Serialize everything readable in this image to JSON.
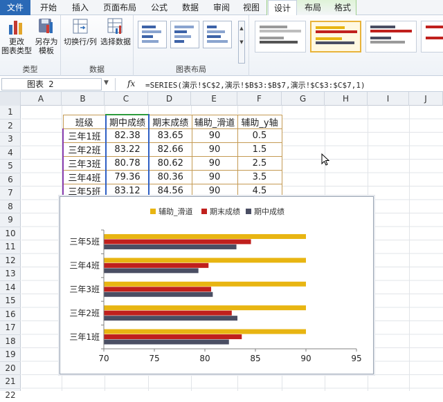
{
  "ribbon": {
    "tabs": [
      {
        "label": "文件"
      },
      {
        "label": "开始"
      },
      {
        "label": "插入"
      },
      {
        "label": "页面布局"
      },
      {
        "label": "公式"
      },
      {
        "label": "数据"
      },
      {
        "label": "审阅"
      },
      {
        "label": "视图"
      },
      {
        "label": "设计"
      },
      {
        "label": "布局"
      },
      {
        "label": "格式"
      }
    ],
    "groups": {
      "type": {
        "label": "类型",
        "change_type": "更改\n图表类型",
        "save_template": "另存为\n模板"
      },
      "data": {
        "label": "数据",
        "switch_row_col": "切换行/列",
        "select_data": "选择数据"
      },
      "layout": {
        "label": "图表布局"
      }
    }
  },
  "formula_bar": {
    "name_box": "图表 2",
    "fx": "fx",
    "formula": "=SERIES(演示!$C$2,演示!$B$3:$B$7,演示!$C$3:$C$7,1)"
  },
  "columns": [
    "A",
    "B",
    "C",
    "D",
    "E",
    "F",
    "G",
    "H",
    "I",
    "J"
  ],
  "rows": [
    "1",
    "2",
    "3",
    "4",
    "5",
    "6",
    "7",
    "8",
    "9",
    "10",
    "11",
    "12",
    "13",
    "14",
    "15",
    "16",
    "17",
    "18",
    "19",
    "20",
    "21",
    "22"
  ],
  "table": {
    "headers": [
      "班级",
      "期中成绩",
      "期末成绩",
      "辅助_滑道",
      "辅助_y轴"
    ],
    "rows": [
      [
        "三年1班",
        "82.38",
        "83.65",
        "90",
        "0.5"
      ],
      [
        "三年2班",
        "83.22",
        "82.66",
        "90",
        "1.5"
      ],
      [
        "三年3班",
        "80.78",
        "80.62",
        "90",
        "2.5"
      ],
      [
        "三年4班",
        "79.36",
        "80.36",
        "90",
        "3.5"
      ],
      [
        "三年5班",
        "83.12",
        "84.56",
        "90",
        "4.5"
      ]
    ]
  },
  "chart_data": {
    "type": "bar",
    "orientation": "horizontal",
    "categories": [
      "三年1班",
      "三年2班",
      "三年3班",
      "三年4班",
      "三年5班"
    ],
    "series": [
      {
        "name": "辅助_滑道",
        "values": [
          90,
          90,
          90,
          90,
          90
        ],
        "color": "#e8b512"
      },
      {
        "name": "期末成绩",
        "values": [
          83.65,
          82.66,
          80.62,
          80.36,
          84.56
        ],
        "color": "#c0201d"
      },
      {
        "name": "期中成绩",
        "values": [
          82.38,
          83.22,
          80.78,
          79.36,
          83.12
        ],
        "color": "#4a4e63"
      }
    ],
    "xlim": [
      70,
      95
    ],
    "xticks": [
      "70",
      "75",
      "80",
      "85",
      "90",
      "95"
    ],
    "legend": "top",
    "grid": false
  }
}
